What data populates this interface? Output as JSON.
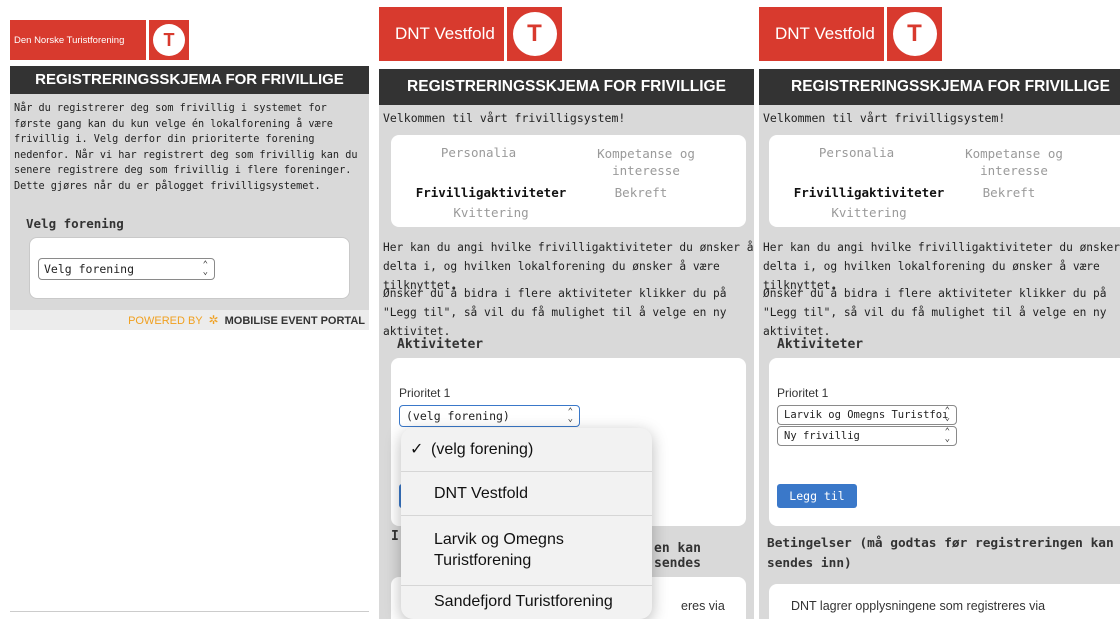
{
  "panel1": {
    "org_name": "Den Norske Turistforening",
    "emblem_letter": "T",
    "title": "REGISTRERINGSSKJEMA FOR FRIVILLIGE",
    "intro": "Når du registrerer deg som frivillig i systemet for første gang kan du kun velge én lokalforening å være frivillig i. Velg derfor din prioriterte forening nedenfor. Når vi har registrert deg som frivillig kan du senere registrere deg som frivillig i flere foreninger. Dette gjøres når du er pålogget frivilligsystemet.",
    "section_label": "Velg forening",
    "select_value": "Velg forening",
    "powered_by": "POWERED BY",
    "powered_brand": "MOBILISE EVENT PORTAL"
  },
  "panel2": {
    "org_name": "DNT Vestfold",
    "emblem_letter": "T",
    "title": "REGISTRERINGSSKJEMA FOR FRIVILLIGE",
    "welcome": "Velkommen til vårt frivilligsystem!",
    "steps": [
      "Personalia",
      "Kompetanse og interesse",
      "Frivilligaktiviteter",
      "Bekreft",
      "Kvittering"
    ],
    "para1": "Her kan du angi hvilke frivilligaktiviteter du ønsker å delta i, og hvilken lokalforening du ønsker å være tilknyttet.",
    "para2": "Ønsker du å bidra i flere aktiviteter klikker du på \"Legg til\", så vil du få mulighet til å velge en ny aktivitet.",
    "section_label": "Aktiviteter",
    "priority_label": "Prioritet 1",
    "select_value": "(velg forening)",
    "dropdown": {
      "checkmark": "✓",
      "options": [
        "(velg forening)",
        "DNT Vestfold",
        "Larvik og Omegns Turistforening",
        "Sandefjord Turistforening"
      ]
    },
    "behind_text_1": "en kan sendes",
    "behind_text_2": "eres via"
  },
  "panel3": {
    "org_name": "DNT Vestfold",
    "emblem_letter": "T",
    "title": "REGISTRERINGSSKJEMA FOR FRIVILLIGE",
    "welcome": "Velkommen til vårt frivilligsystem!",
    "steps": [
      "Personalia",
      "Kompetanse og interesse",
      "Frivilligaktiviteter",
      "Bekreft",
      "Kvittering"
    ],
    "para1": "Her kan du angi hvilke frivilligaktiviteter du ønsker å delta i, og hvilken lokalforening du ønsker å være tilknyttet.",
    "para2": "Ønsker du å bidra i flere aktiviteter klikker du på \"Legg til\", så vil du få mulighet til å velge en ny aktivitet.",
    "section_label": "Aktiviteter",
    "priority_label": "Prioritet 1",
    "select_forening": "Larvik og Omegns Turistfoı",
    "select_type": "Ny frivillig",
    "add_button": "Legg til",
    "conditions_title": "Betingelser (må godtas før registreringen kan sendes inn)",
    "conditions_text": "DNT lagrer opplysningene som registreres via"
  },
  "colors": {
    "brand_red": "#d83a2e",
    "title_bar": "#333333",
    "panel_grey": "#d9d9d9",
    "button_blue": "#3a78c9",
    "powered_orange": "#f0a020"
  },
  "icons": [
    "dnt-emblem-icon",
    "chevron-updown-icon",
    "checkmark-icon",
    "mobilise-logo-icon"
  ]
}
